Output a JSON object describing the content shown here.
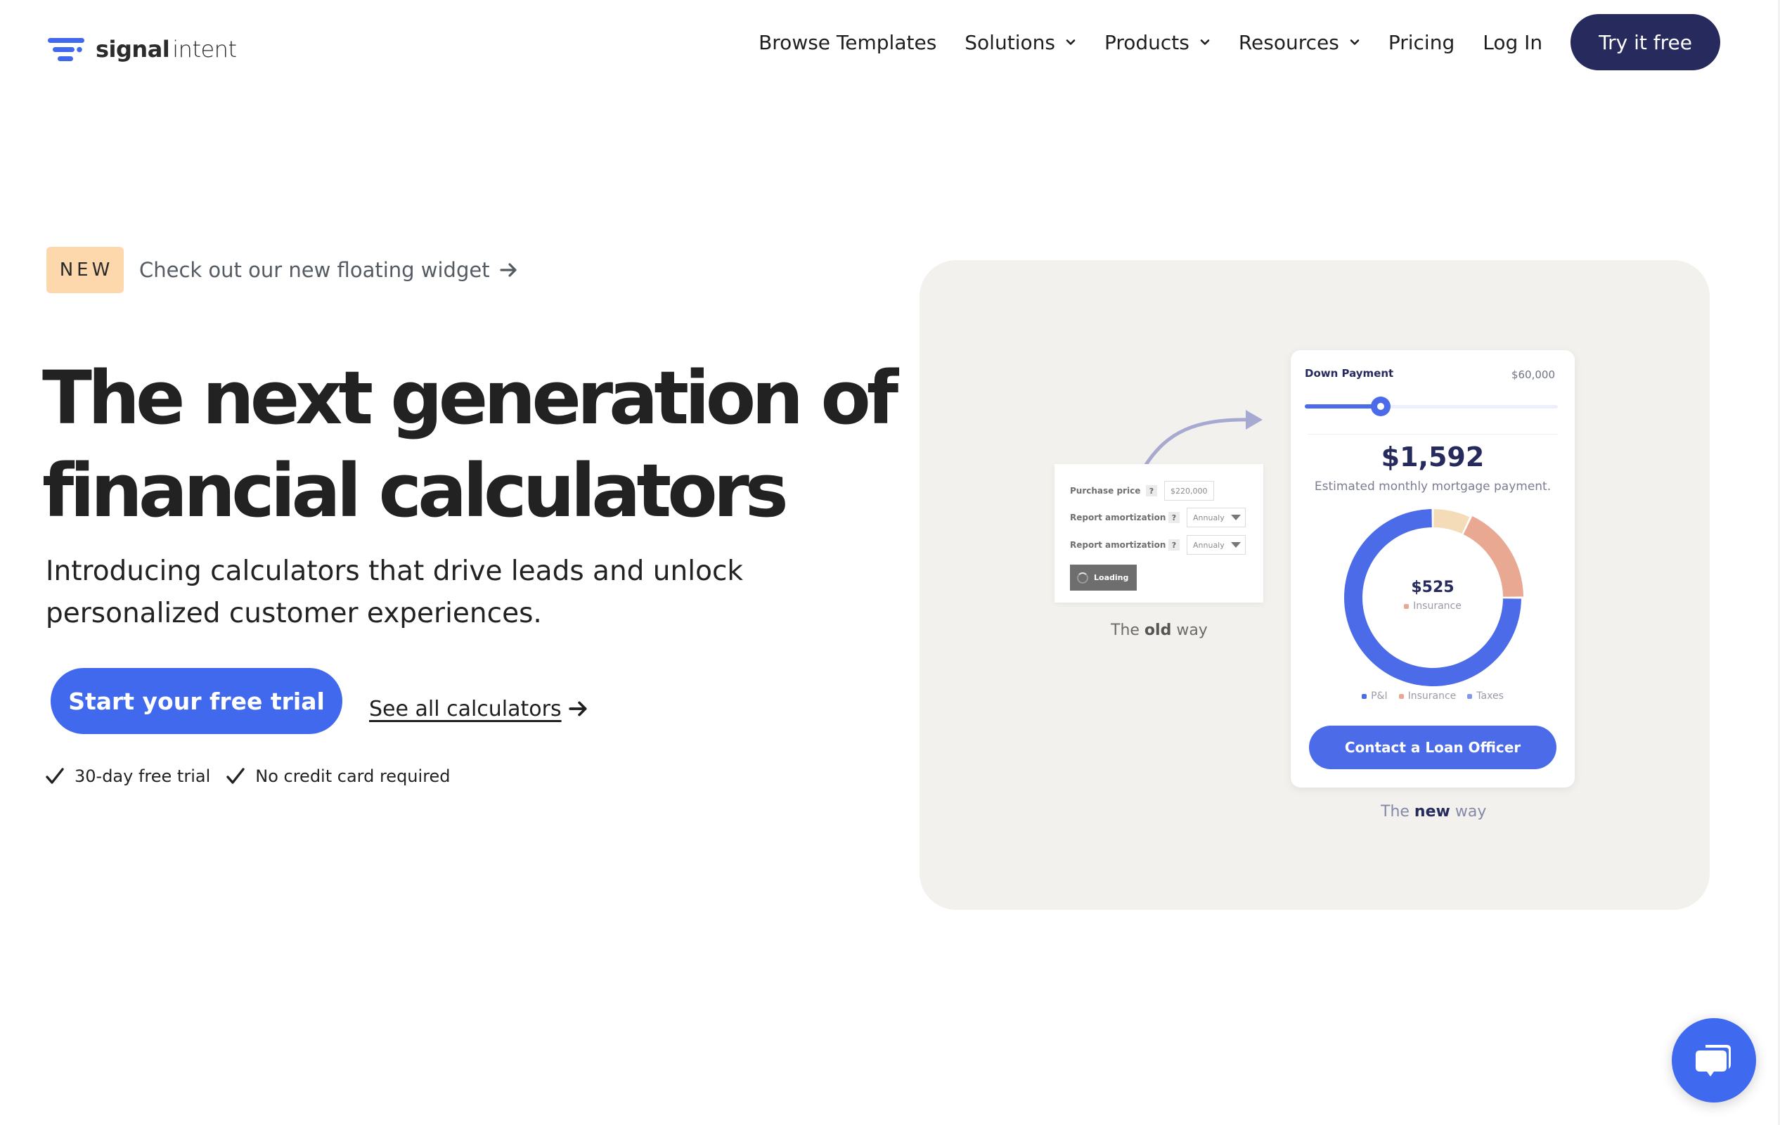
{
  "brand": {
    "name_bold": "signal",
    "name_light": "intent",
    "logo_color": "#4169ed"
  },
  "nav": {
    "items": [
      {
        "label": "Browse Templates",
        "has_dropdown": false
      },
      {
        "label": "Solutions",
        "has_dropdown": true
      },
      {
        "label": "Products",
        "has_dropdown": true
      },
      {
        "label": "Resources",
        "has_dropdown": true
      },
      {
        "label": "Pricing",
        "has_dropdown": false
      },
      {
        "label": "Log In",
        "has_dropdown": false
      }
    ],
    "cta_label": "Try it free",
    "cta_color": "#262a5c"
  },
  "hero": {
    "badge": "NEW",
    "announcement": "Check out our new floating widget",
    "headline_line1": "The next generation of",
    "headline_line2": "financial calculators",
    "subtitle": "Introducing calculators that drive leads and unlock personalized customer experiences.",
    "primary_cta": "Start your free trial",
    "secondary_cta": "See all calculators",
    "checks": [
      "30-day free trial",
      "No credit card required"
    ],
    "accent_color": "#4169ed"
  },
  "illustration": {
    "old_way": {
      "fields": [
        {
          "label": "Purchase price",
          "help": "?",
          "value": "$220,000",
          "type": "input"
        },
        {
          "label": "Report amortization",
          "help": "?",
          "value": "Annualy",
          "type": "select"
        },
        {
          "label": "Report amortization",
          "help": "?",
          "value": "Annualy",
          "type": "select"
        }
      ],
      "loading_label": "Loading",
      "caption_pre": "The",
      "caption_bold": "old",
      "caption_post": "way"
    },
    "new_way": {
      "slider_label": "Down Payment",
      "slider_value": "$60,000",
      "slider_fraction": 0.3,
      "monthly_payment": "$1,592",
      "monthly_caption": "Estimated monthly mortgage payment.",
      "center_amount": "$525",
      "center_label": "Insurance",
      "legend": [
        {
          "label": "P&I",
          "color": "#4b6be8"
        },
        {
          "label": "Insurance",
          "color": "#e9a892"
        },
        {
          "label": "Taxes",
          "color": "#8097ee"
        }
      ],
      "donut_segments": [
        {
          "name": "Taxes-highlight",
          "fraction": 0.07,
          "color": "#f5dcb8"
        },
        {
          "name": "Insurance",
          "fraction": 0.18,
          "color": "#e9a892"
        },
        {
          "name": "P&I",
          "fraction": 0.75,
          "color": "#4b6be8"
        }
      ],
      "contact_label": "Contact a Loan Officer",
      "caption_pre": "The",
      "caption_bold": "new",
      "caption_post": "way"
    },
    "panel_color": "#f3f1ed"
  },
  "chat": {
    "icon": "chat-bubbles-icon",
    "color": "#3f69ee"
  }
}
